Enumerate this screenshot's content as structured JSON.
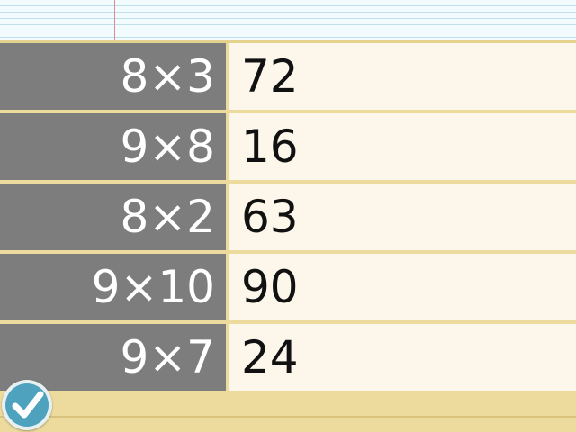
{
  "quiz": {
    "rows": [
      {
        "problem": "8×3",
        "answer": "72"
      },
      {
        "problem": "9×8",
        "answer": "16"
      },
      {
        "problem": "8×2",
        "answer": "63"
      },
      {
        "problem": "9×10",
        "answer": "90"
      },
      {
        "problem": "9×7",
        "answer": "24"
      }
    ]
  },
  "colors": {
    "problem_bg": "#7d7d7d",
    "answer_bg": "#fcf7ea",
    "separator": "#ecdb9c",
    "check_button": "#4ea2be"
  },
  "icons": {
    "submit": "checkmark-icon"
  }
}
